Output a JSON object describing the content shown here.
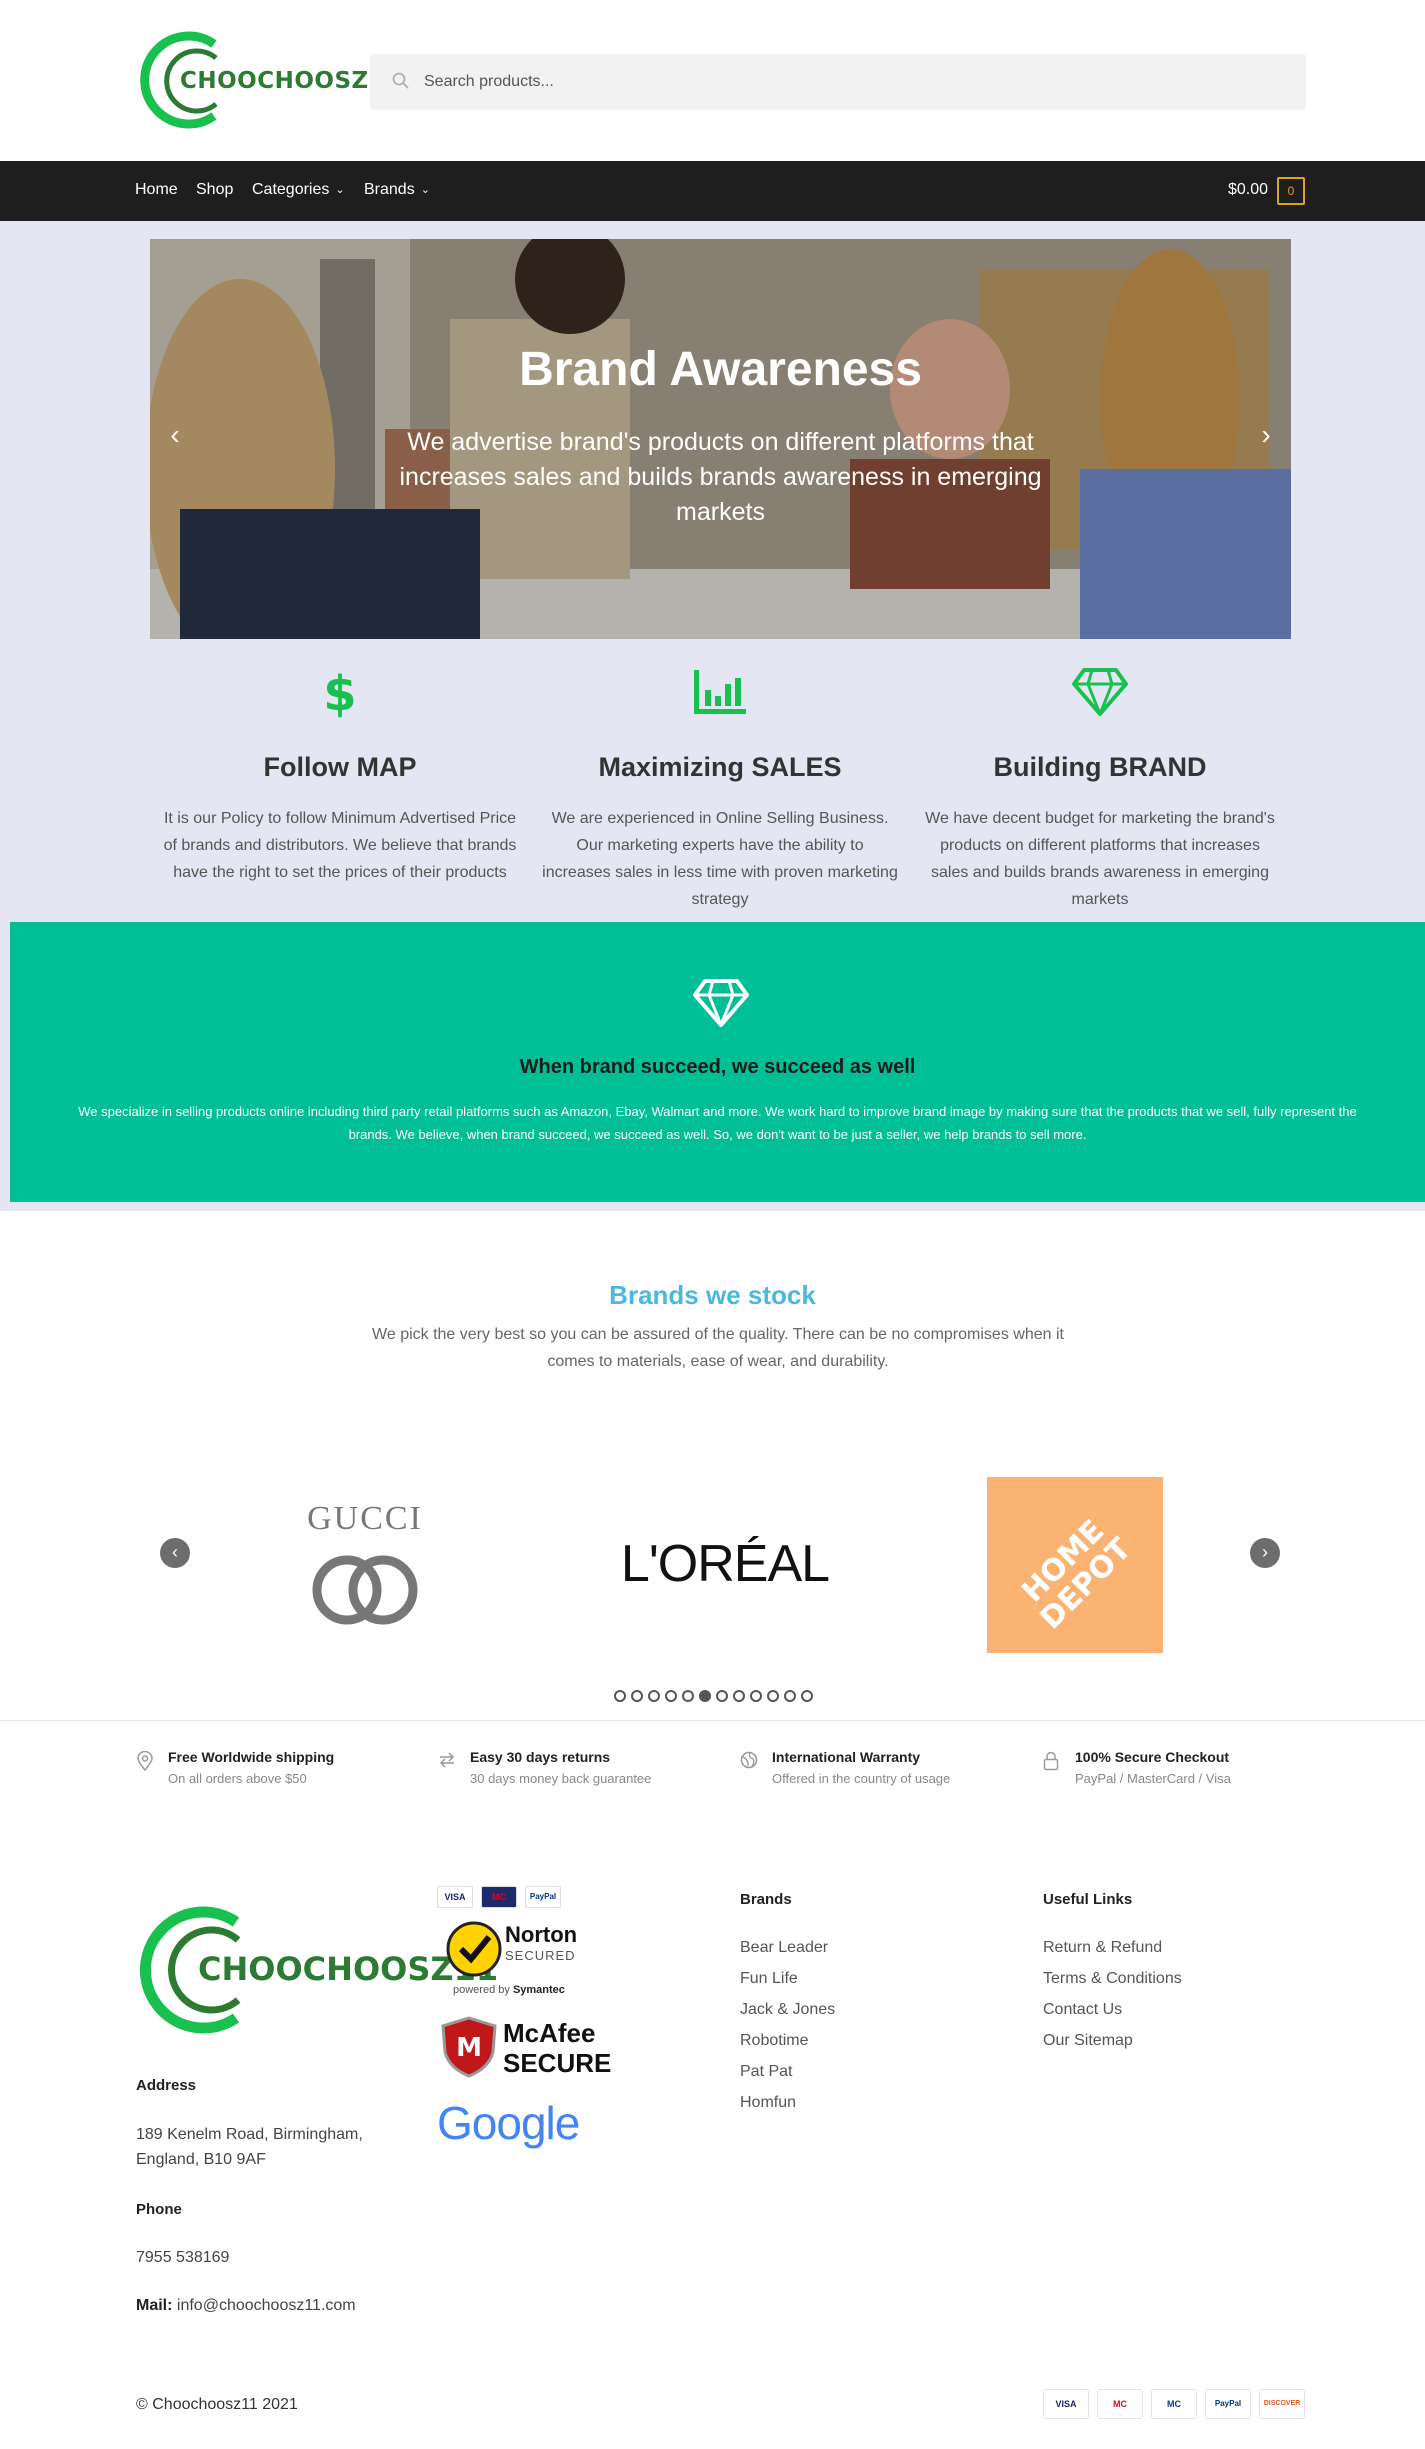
{
  "header": {
    "logo_text": "CHOOCHOOSZ11",
    "search_placeholder": "Search products..."
  },
  "nav": {
    "items": [
      {
        "label": "Home"
      },
      {
        "label": "Shop"
      },
      {
        "label": "Categories",
        "dropdown": true
      },
      {
        "label": "Brands",
        "dropdown": true
      }
    ],
    "cart_total": "$0.00",
    "cart_count": "0"
  },
  "slider": {
    "title": "Brand Awareness",
    "text": "We advertise brand's products on different platforms that increases sales and builds brands awareness in emerging markets",
    "prev": "‹",
    "next": "›"
  },
  "features": [
    {
      "icon": "dollar-icon",
      "title": "Follow MAP",
      "text": "It is our Policy to follow Minimum Advertised Price of brands and distributors. We believe that brands have the right to set the prices of their products"
    },
    {
      "icon": "bar-chart-icon",
      "title": "Maximizing SALES",
      "text": "We are experienced in Online Selling Business. Our marketing experts have the ability to increases sales in less time with proven marketing strategy"
    },
    {
      "icon": "diamond-icon",
      "title": "Building BRAND",
      "text": "We have decent budget for marketing the brand's products on different platforms that increases sales and builds brands awareness in emerging markets"
    }
  ],
  "mission": {
    "icon": "diamond-icon",
    "title": "When brand succeed, we succeed as well",
    "text": "We specialize in selling products online including third party retail platforms such as Amazon, Ebay, Walmart and more. We work hard to improve brand image by making sure that the products that we sell, fully represent the brands. We believe, when brand succeed, we succeed as well. So, we don't want to be just a seller, we help brands to sell more."
  },
  "brands": {
    "title": "Brands we stock",
    "subtitle": "We pick the very best so you can be assured of the quality. There can be no compromises when it comes to materials, ease of wear, and durability.",
    "logos": [
      {
        "name": "GUCCI"
      },
      {
        "name": "L'ORÉAL"
      },
      {
        "name": "HOME DEPOT"
      }
    ],
    "dot_count": 13,
    "active_dot": 5
  },
  "info_row": [
    {
      "icon": "location-pin-icon",
      "title": "Free Worldwide shipping",
      "sub": "On all orders above $50"
    },
    {
      "icon": "exchange-arrows-icon",
      "title": "Easy 30 days returns",
      "sub": "30 days money back guarantee"
    },
    {
      "icon": "globe-icon",
      "title": "International Warranty",
      "sub": "Offered in the country of usage"
    },
    {
      "icon": "lock-icon",
      "title": "100% Secure Checkout",
      "sub": "PayPal / MasterCard / Visa"
    }
  ],
  "footer": {
    "logo_text": "CHOOCHOOSZ11",
    "address_label": "Address",
    "address_line1": "189 Kenelm Road, Birmingham,",
    "address_line2": "England, B10 9AF",
    "phone_label": "Phone",
    "phone": "7955 538169",
    "mail_label": "Mail:",
    "mail": "info@choochoosz11.com",
    "badges": {
      "pay": [
        "VISA",
        "MC",
        "PayPal"
      ],
      "norton_title": "Norton",
      "norton_sub": "SECURED",
      "norton_by": "powered by",
      "norton_brand": "Symantec",
      "mcafee_title": "McAfee",
      "mcafee_sub": "SECURE",
      "google": "Google"
    },
    "brands_heading": "Brands",
    "brands": [
      "Bear Leader",
      "Fun Life",
      "Jack & Jones",
      "Robotime",
      "Pat Pat",
      "Homfun"
    ],
    "links_heading": "Useful Links",
    "links": [
      "Return & Refund",
      "Terms & Conditions",
      "Contact Us",
      "Our Sitemap"
    ],
    "copyright": "© Choochoosz11  2021",
    "cards": [
      "VISA",
      "MC",
      "MC",
      "PayPal",
      "DISCOVER"
    ]
  },
  "colors": {
    "accent_green": "#00bf96",
    "icon_green": "#18c04d",
    "brands_title": "#4bb8e0",
    "nav_bg": "#1e1e1e",
    "band_bg": "#e4e7f3",
    "cart_accent": "#e0a11b"
  }
}
